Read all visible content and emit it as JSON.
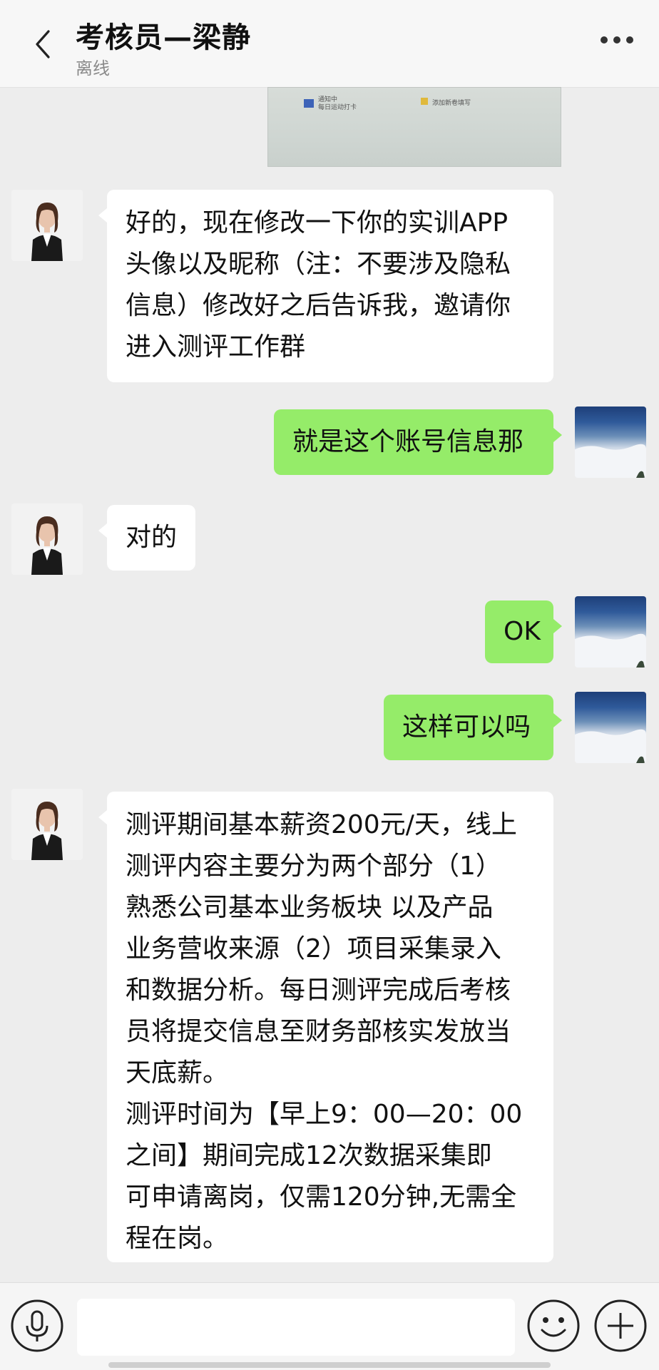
{
  "header": {
    "title": "考核员—梁静",
    "status": "离线"
  },
  "preview": {
    "left_text_1": "通知中",
    "left_text_2": "每日运动打卡",
    "right_text": "添加新卷填写"
  },
  "messages": [
    {
      "side": "left",
      "avatar": "person",
      "text": "好的，现在修改一下你的实训APP\n头像以及昵称（注：不要涉及隐私\n信息）修改好之后告诉我，邀请你\n进入测评工作群"
    },
    {
      "side": "right",
      "avatar": "sky",
      "text": "就是这个账号信息那"
    },
    {
      "side": "left",
      "avatar": "person",
      "text": "对的"
    },
    {
      "side": "right",
      "avatar": "sky",
      "text": "OK"
    },
    {
      "side": "right",
      "avatar": "sky",
      "text": "这样可以吗"
    },
    {
      "side": "left",
      "avatar": "person",
      "text": "测评期间基本薪资200元/天，线上\n测评内容主要分为两个部分（1）\n熟悉公司基本业务板块 以及产品\n业务营收来源（2）项目采集录入\n和数据分析。每日测评完成后考核\n员将提交信息至财务部核实发放当\n天底薪。\n测评时间为【早上9：00—20：00\n之间】期间完成12次数据采集即\n可申请离岗，仅需120分钟,无需全\n程在岗。"
    }
  ],
  "input": {
    "value": "",
    "placeholder": ""
  },
  "icons": {
    "back": "chevron-left-icon",
    "more": "more-dots-icon",
    "voice": "microphone-icon",
    "emoji": "smiley-icon",
    "plus": "plus-icon"
  },
  "colors": {
    "background": "#ededed",
    "incoming_bubble": "#ffffff",
    "outgoing_bubble": "#95ec69",
    "header": "#f7f7f7"
  }
}
